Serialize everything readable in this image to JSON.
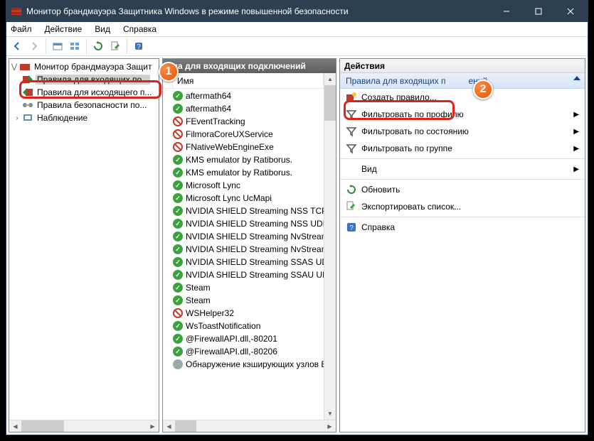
{
  "titlebar": {
    "title": "Монитор брандмауэра Защитника Windows в режиме повышенной безопасности"
  },
  "menubar": {
    "file": "Файл",
    "action": "Действие",
    "view": "Вид",
    "help": "Справка"
  },
  "tree": {
    "root": "Монитор брандмауэра Защит",
    "inbound": "Правила для входящих по...",
    "outbound": "Правила для исходящего п...",
    "conn_sec": "Правила безопасности по...",
    "monitoring": "Наблюдение"
  },
  "center": {
    "header_suffix": "ила для входящих подключений",
    "col_name": "Имя",
    "rules": [
      {
        "icon": "allow",
        "name": "aftermath64"
      },
      {
        "icon": "allow",
        "name": "aftermath64"
      },
      {
        "icon": "block",
        "name": "FEventTracking"
      },
      {
        "icon": "block",
        "name": "FilmoraCoreUXService"
      },
      {
        "icon": "block",
        "name": "FNativeWebEngineExe"
      },
      {
        "icon": "allow",
        "name": "KMS emulator by Ratiborus."
      },
      {
        "icon": "allow",
        "name": "KMS emulator by Ratiborus."
      },
      {
        "icon": "allow",
        "name": "Microsoft Lync"
      },
      {
        "icon": "allow",
        "name": "Microsoft Lync UcMapi"
      },
      {
        "icon": "allow",
        "name": "NVIDIA SHIELD Streaming NSS TCP Excep"
      },
      {
        "icon": "allow",
        "name": "NVIDIA SHIELD Streaming NSS UDP Exce"
      },
      {
        "icon": "allow",
        "name": "NVIDIA SHIELD Streaming NvStreamer TC"
      },
      {
        "icon": "allow",
        "name": "NVIDIA SHIELD Streaming NvStreamer U..."
      },
      {
        "icon": "allow",
        "name": "NVIDIA SHIELD Streaming SSAS UDP Exc..."
      },
      {
        "icon": "allow",
        "name": "NVIDIA SHIELD Streaming SSAU UDP Exc"
      },
      {
        "icon": "allow",
        "name": "Steam"
      },
      {
        "icon": "allow",
        "name": "Steam"
      },
      {
        "icon": "block",
        "name": "WSHelper32"
      },
      {
        "icon": "allow",
        "name": "WsToastNotification"
      },
      {
        "icon": "allow",
        "name": "@FirewallAPI.dll,-80201"
      },
      {
        "icon": "allow",
        "name": "@FirewallAPI.dll,-80206"
      },
      {
        "icon": "disabled",
        "name": "Обнаружение кэширующих узлов Bra..."
      }
    ]
  },
  "actions": {
    "header": "Действия",
    "section_title_prefix": "Правила для входящих п",
    "section_title_suffix": "ений",
    "items": {
      "new_rule": "Создать правило...",
      "filter_profile": "Фильтровать по профилю",
      "filter_state": "Фильтровать по состоянию",
      "filter_group": "Фильтровать по группе",
      "view": "Вид",
      "refresh": "Обновить",
      "export": "Экспортировать список...",
      "help": "Справка"
    }
  },
  "annotations": {
    "badge1": "1",
    "badge2": "2"
  }
}
